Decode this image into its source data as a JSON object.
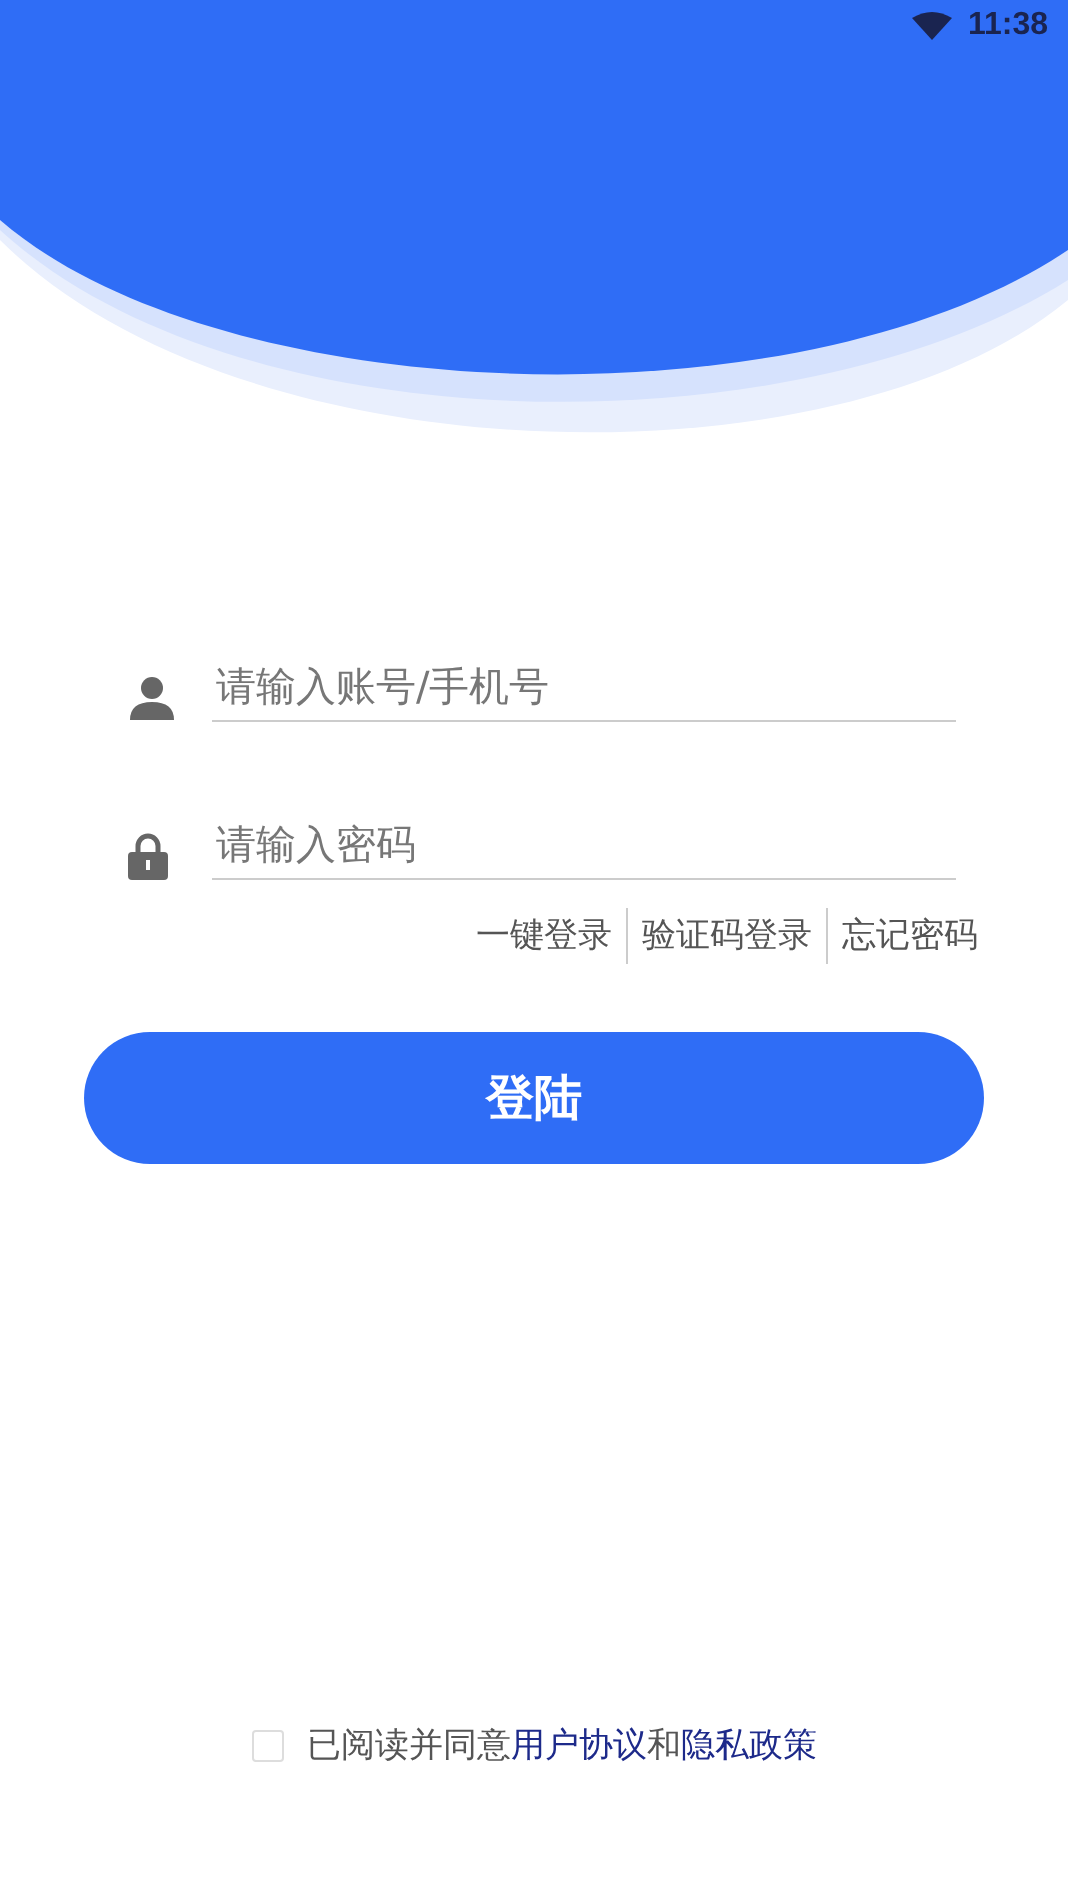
{
  "status_bar": {
    "time": "11:38"
  },
  "username": {
    "placeholder": "请输入账号/手机号"
  },
  "password": {
    "placeholder": "请输入密码"
  },
  "links": [
    "一键登录",
    "验证码登录",
    "忘记密码"
  ],
  "login_button": {
    "label": "登陆"
  },
  "agreement": {
    "checked": false,
    "prefix": "已阅读并同意",
    "link_1": "用户协议",
    "joiner": "和",
    "link_2": "隐私政策"
  }
}
